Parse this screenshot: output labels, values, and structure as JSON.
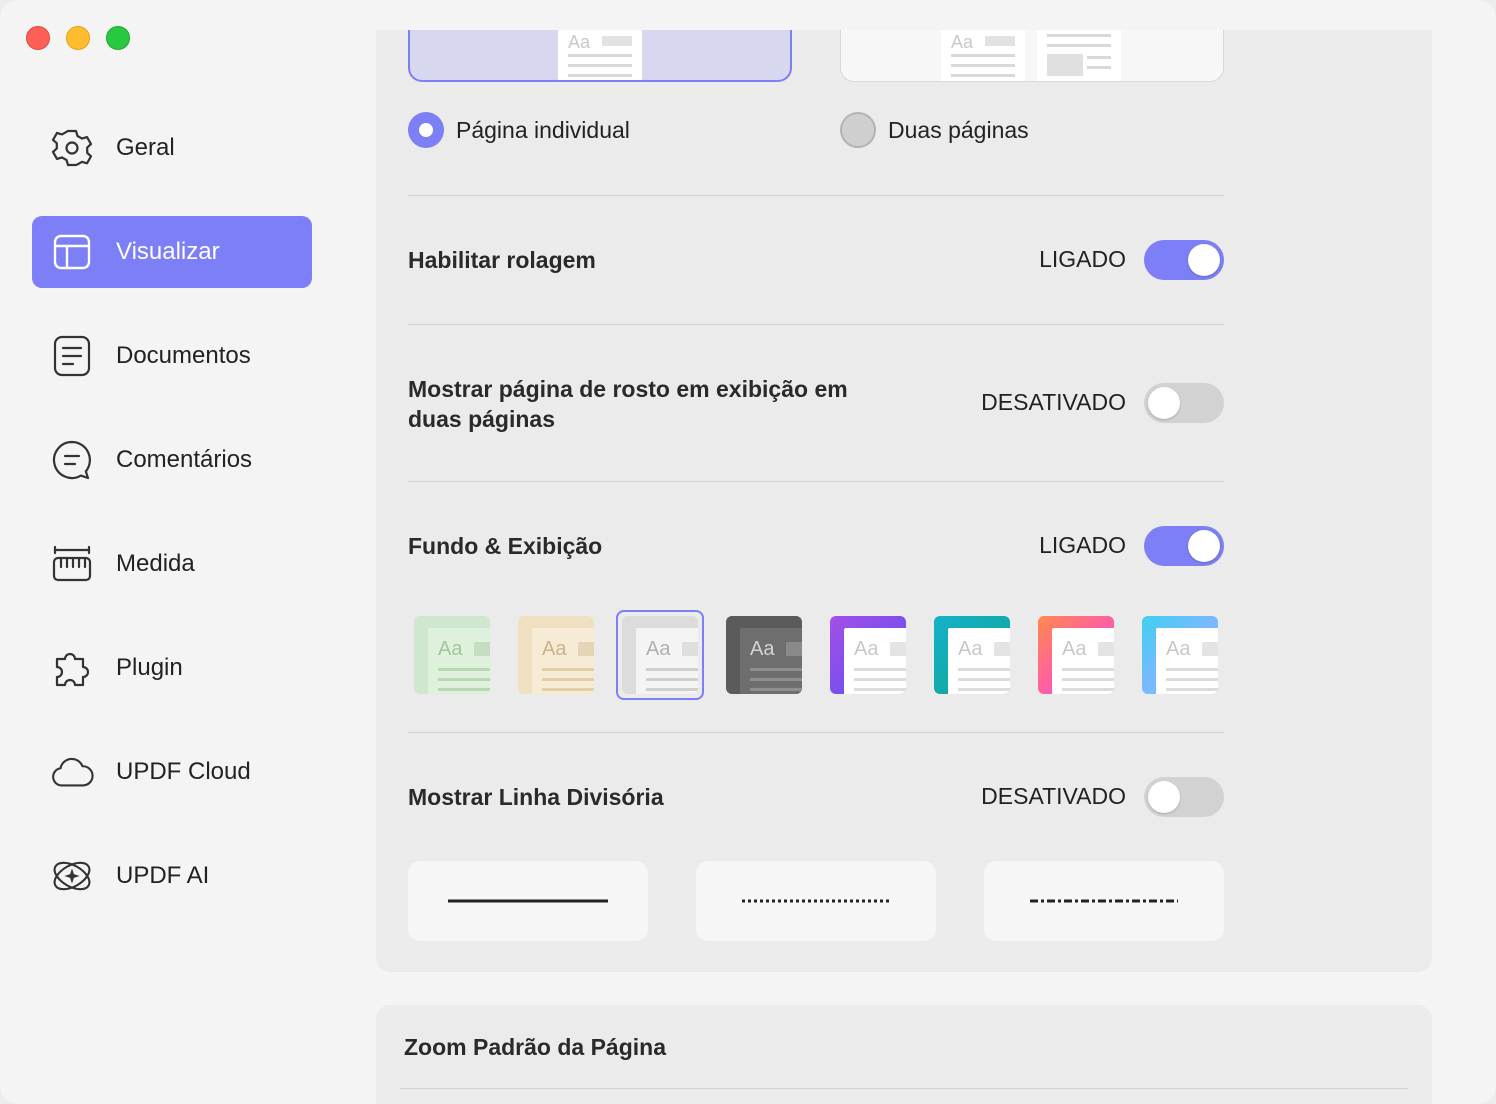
{
  "window": {
    "controls": [
      "close",
      "minimize",
      "maximize"
    ]
  },
  "sidebar": {
    "items": [
      {
        "label": "Geral",
        "icon": "gear-icon",
        "active": false
      },
      {
        "label": "Visualizar",
        "icon": "layout-icon",
        "active": true
      },
      {
        "label": "Documentos",
        "icon": "document-icon",
        "active": false
      },
      {
        "label": "Comentários",
        "icon": "comment-icon",
        "active": false
      },
      {
        "label": "Medida",
        "icon": "ruler-icon",
        "active": false
      },
      {
        "label": "Plugin",
        "icon": "puzzle-icon",
        "active": false
      },
      {
        "label": "UPDF Cloud",
        "icon": "cloud-icon",
        "active": false
      },
      {
        "label": "UPDF AI",
        "icon": "ai-icon",
        "active": false
      }
    ]
  },
  "layout": {
    "options": [
      {
        "label": "Página individual",
        "selected": true
      },
      {
        "label": "Duas páginas",
        "selected": false
      }
    ],
    "thumb_text": "Aa"
  },
  "settings": {
    "scroll": {
      "label": "Habilitar rolagem",
      "status": "LIGADO",
      "on": true
    },
    "cover": {
      "label_line1": "Mostrar página de rosto em exibição em",
      "label_line2": "duas páginas",
      "status": "DESATIVADO",
      "on": false
    },
    "background": {
      "label": "Fundo & Exibição",
      "status": "LIGADO",
      "on": true
    },
    "divider": {
      "label": "Mostrar Linha Divisória",
      "status": "DESATIVADO",
      "on": false
    }
  },
  "themes": {
    "selected_index": 2,
    "sample_text": "Aa",
    "items": [
      "green",
      "beige",
      "light-gray",
      "dark-gray",
      "purple",
      "teal",
      "gradient-pink",
      "gradient-cyan"
    ]
  },
  "divider_styles": [
    "solid",
    "dotted",
    "dash-dot"
  ],
  "zoom": {
    "title": "Zoom Padrão da Página"
  },
  "colors": {
    "accent": "#7c7ff5",
    "sidebar_bg": "#f4f4f4",
    "panel_bg": "#ebebeb"
  }
}
